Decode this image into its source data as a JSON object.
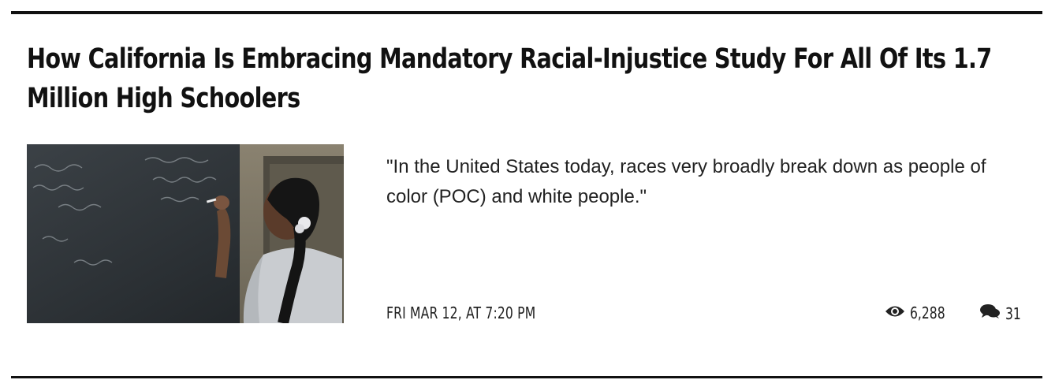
{
  "article": {
    "headline": "How California Is Embracing Mandatory Racial-Injustice Study For All Of Its 1.7 Million High Schoolers",
    "excerpt": "\"In the United States today, races very broadly break down as people of color (POC) and white people.\"",
    "date": "FRI MAR 12, AT 7:20 PM",
    "views": "6,288",
    "comments": "31",
    "image": {
      "description_icon": "photo-thumbnail"
    }
  },
  "icons": {
    "views": "eye-icon",
    "comments": "comments-icon"
  },
  "colors": {
    "text": "#111111",
    "rule": "#111111",
    "background": "#ffffff"
  }
}
